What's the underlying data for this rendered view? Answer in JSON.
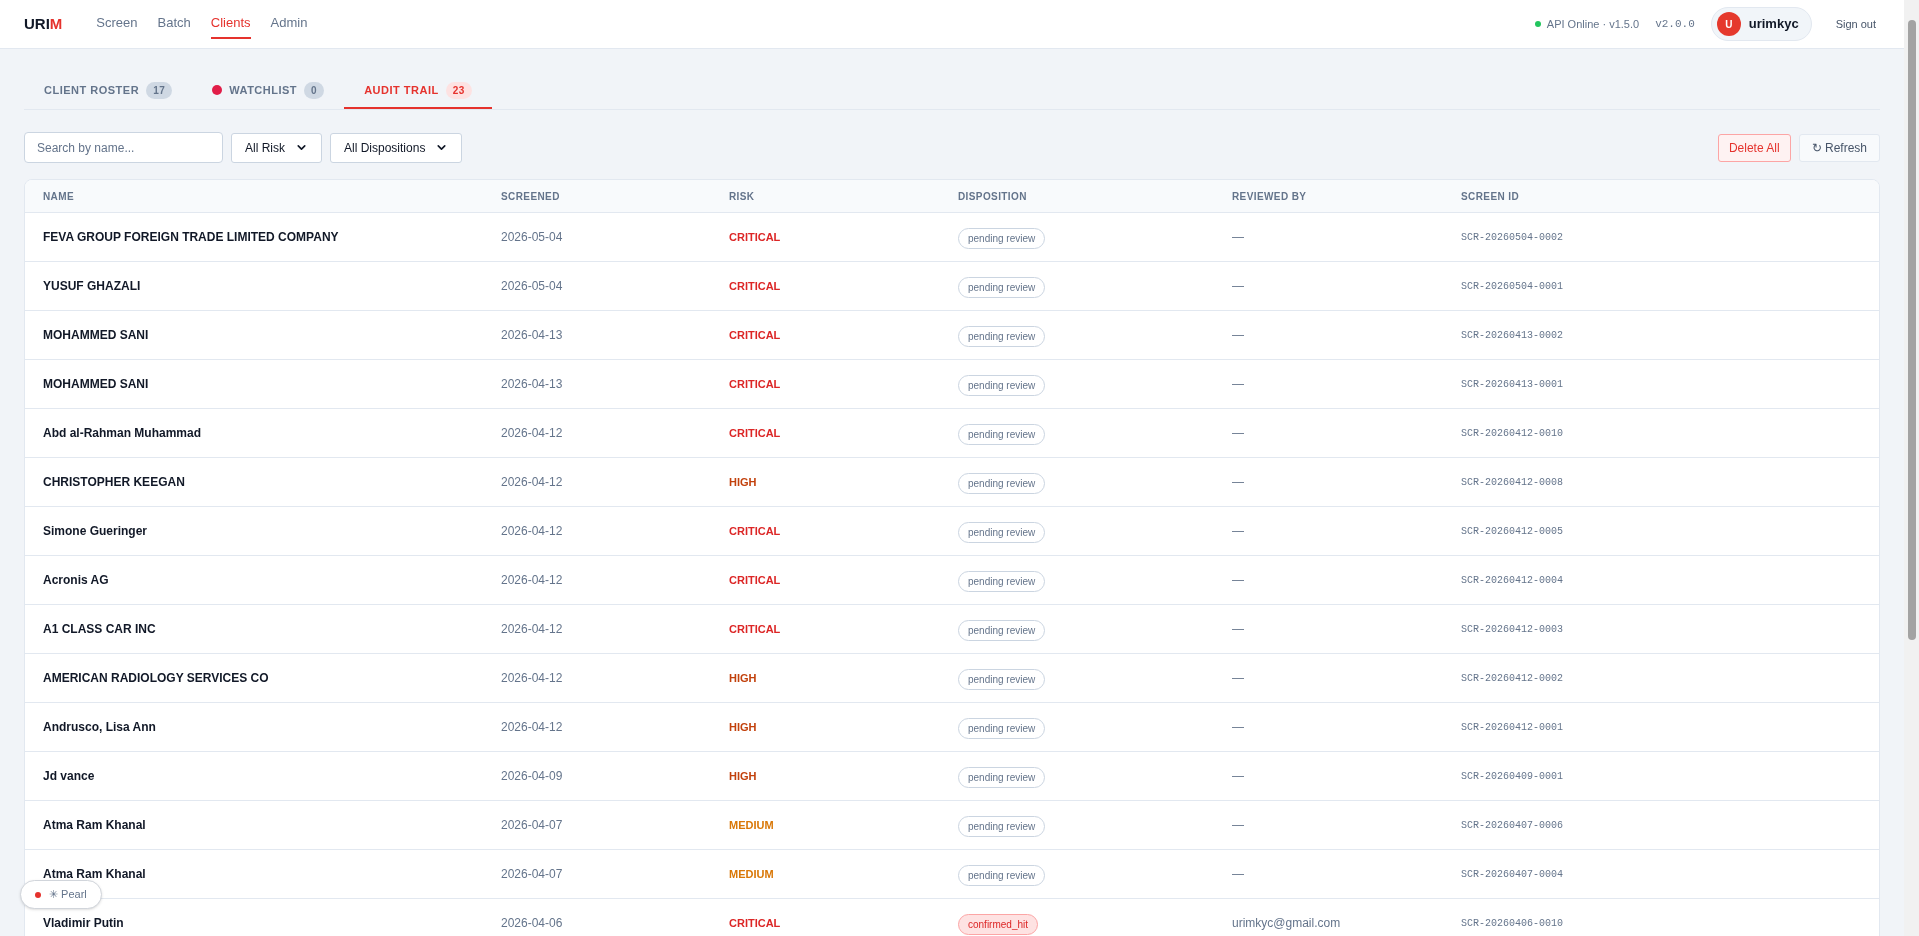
{
  "logo": {
    "main": "URI",
    "accent": "M"
  },
  "nav": [
    {
      "label": "Screen",
      "selected": false
    },
    {
      "label": "Batch",
      "selected": false
    },
    {
      "label": "Clients",
      "selected": true
    },
    {
      "label": "Admin",
      "selected": false
    }
  ],
  "api_status": {
    "text": "API Online · v1.5.0",
    "online": true
  },
  "version": "v2.0.0",
  "user": {
    "initial": "U",
    "name": "urimkyc"
  },
  "sign_out": "Sign out",
  "tabs": [
    {
      "label": "CLIENT ROSTER",
      "count": "17",
      "selected": false,
      "dot": false
    },
    {
      "label": "WATCHLIST",
      "count": "0",
      "selected": false,
      "dot": true
    },
    {
      "label": "AUDIT TRAIL",
      "count": "23",
      "selected": true,
      "dot": false
    }
  ],
  "search": {
    "placeholder": "Search by name..."
  },
  "filters": [
    {
      "value": "All Risk"
    },
    {
      "value": "All Dispositions"
    }
  ],
  "actions": {
    "delete": "Delete All",
    "refresh": "↻ Refresh"
  },
  "table": {
    "columns": [
      "NAME",
      "SCREENED",
      "RISK",
      "DISPOSITION",
      "REVIEWED BY",
      "SCREEN ID"
    ],
    "rows": [
      {
        "name": "FEVA GROUP FOREIGN TRADE LIMITED COMPANY",
        "screened": "2026-05-04",
        "risk": {
          "text": "CRITICAL",
          "color": "#dc2626"
        },
        "disposition": {
          "text": "pending review",
          "kind": "pending"
        },
        "reviewed_by": "—",
        "screen_id": "SCR-20260504-0002"
      },
      {
        "name": "YUSUF GHAZALI",
        "screened": "2026-05-04",
        "risk": {
          "text": "CRITICAL",
          "color": "#dc2626"
        },
        "disposition": {
          "text": "pending review",
          "kind": "pending"
        },
        "reviewed_by": "—",
        "screen_id": "SCR-20260504-0001"
      },
      {
        "name": "MOHAMMED SANI",
        "screened": "2026-04-13",
        "risk": {
          "text": "CRITICAL",
          "color": "#dc2626"
        },
        "disposition": {
          "text": "pending review",
          "kind": "pending"
        },
        "reviewed_by": "—",
        "screen_id": "SCR-20260413-0002"
      },
      {
        "name": "MOHAMMED SANI",
        "screened": "2026-04-13",
        "risk": {
          "text": "CRITICAL",
          "color": "#dc2626"
        },
        "disposition": {
          "text": "pending review",
          "kind": "pending"
        },
        "reviewed_by": "—",
        "screen_id": "SCR-20260413-0001"
      },
      {
        "name": "Abd al-Rahman Muhammad",
        "screened": "2026-04-12",
        "risk": {
          "text": "CRITICAL",
          "color": "#dc2626"
        },
        "disposition": {
          "text": "pending review",
          "kind": "pending"
        },
        "reviewed_by": "—",
        "screen_id": "SCR-20260412-0010"
      },
      {
        "name": "CHRISTOPHER KEEGAN",
        "screened": "2026-04-12",
        "risk": {
          "text": "HIGH",
          "color": "#c2410c"
        },
        "disposition": {
          "text": "pending review",
          "kind": "pending"
        },
        "reviewed_by": "—",
        "screen_id": "SCR-20260412-0008"
      },
      {
        "name": "Simone Gueringer",
        "screened": "2026-04-12",
        "risk": {
          "text": "CRITICAL",
          "color": "#dc2626"
        },
        "disposition": {
          "text": "pending review",
          "kind": "pending"
        },
        "reviewed_by": "—",
        "screen_id": "SCR-20260412-0005"
      },
      {
        "name": "Acronis AG",
        "screened": "2026-04-12",
        "risk": {
          "text": "CRITICAL",
          "color": "#dc2626"
        },
        "disposition": {
          "text": "pending review",
          "kind": "pending"
        },
        "reviewed_by": "—",
        "screen_id": "SCR-20260412-0004"
      },
      {
        "name": "A1 CLASS CAR INC",
        "screened": "2026-04-12",
        "risk": {
          "text": "CRITICAL",
          "color": "#dc2626"
        },
        "disposition": {
          "text": "pending review",
          "kind": "pending"
        },
        "reviewed_by": "—",
        "screen_id": "SCR-20260412-0003"
      },
      {
        "name": "AMERICAN RADIOLOGY SERVICES CO",
        "screened": "2026-04-12",
        "risk": {
          "text": "HIGH",
          "color": "#c2410c"
        },
        "disposition": {
          "text": "pending review",
          "kind": "pending"
        },
        "reviewed_by": "—",
        "screen_id": "SCR-20260412-0002"
      },
      {
        "name": "Andrusco, Lisa Ann",
        "screened": "2026-04-12",
        "risk": {
          "text": "HIGH",
          "color": "#c2410c"
        },
        "disposition": {
          "text": "pending review",
          "kind": "pending"
        },
        "reviewed_by": "—",
        "screen_id": "SCR-20260412-0001"
      },
      {
        "name": "Jd vance",
        "screened": "2026-04-09",
        "risk": {
          "text": "HIGH",
          "color": "#c2410c"
        },
        "disposition": {
          "text": "pending review",
          "kind": "pending"
        },
        "reviewed_by": "—",
        "screen_id": "SCR-20260409-0001"
      },
      {
        "name": "Atma Ram Khanal",
        "screened": "2026-04-07",
        "risk": {
          "text": "MEDIUM",
          "color": "#d97706"
        },
        "disposition": {
          "text": "pending review",
          "kind": "pending"
        },
        "reviewed_by": "—",
        "screen_id": "SCR-20260407-0006"
      },
      {
        "name": "Atma Ram Khanal",
        "screened": "2026-04-07",
        "risk": {
          "text": "MEDIUM",
          "color": "#d97706"
        },
        "disposition": {
          "text": "pending review",
          "kind": "pending"
        },
        "reviewed_by": "—",
        "screen_id": "SCR-20260407-0004"
      },
      {
        "name": "Vladimir Putin",
        "screened": "2026-04-06",
        "risk": {
          "text": "CRITICAL",
          "color": "#dc2626"
        },
        "disposition": {
          "text": "confirmed_hit",
          "kind": "confirmed"
        },
        "reviewed_by": "urimkyc@gmail.com",
        "screen_id": "SCR-20260406-0010"
      }
    ]
  },
  "assistant": {
    "label": "✳ Pearl",
    "online": true
  }
}
